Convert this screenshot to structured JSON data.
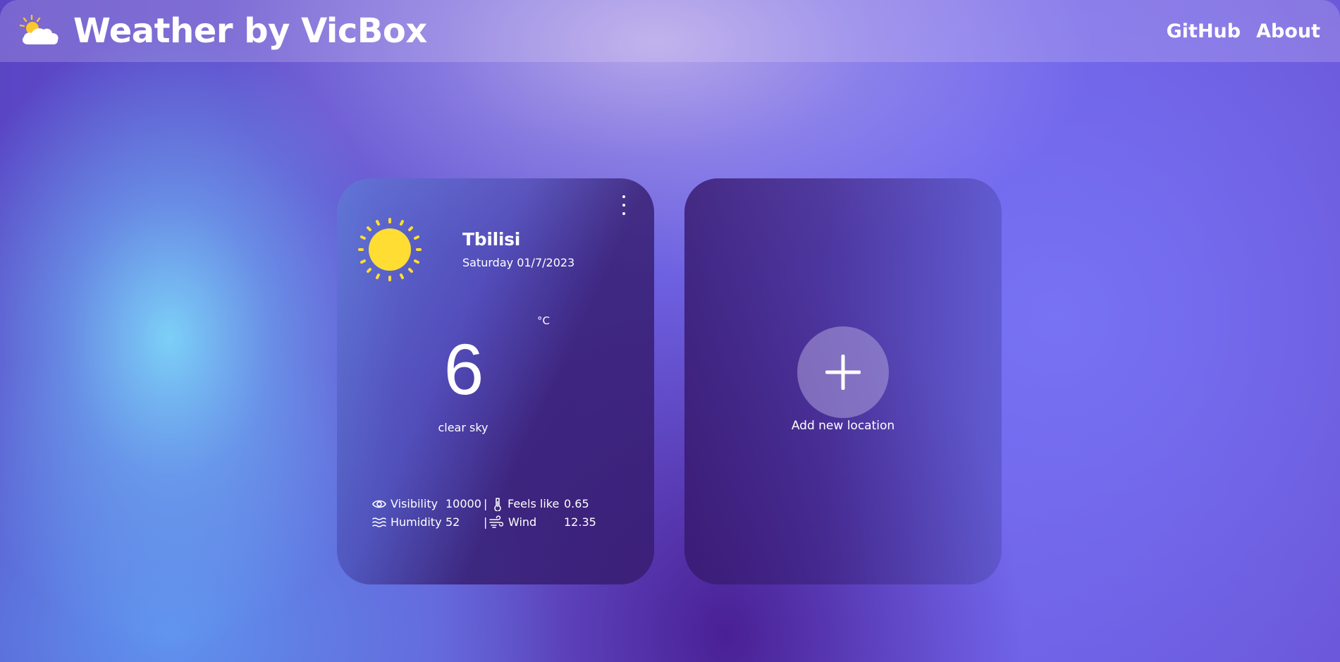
{
  "header": {
    "title": "Weather by VicBox",
    "logo_icon": "partly-cloudy-icon",
    "nav": {
      "github": "GitHub",
      "about": "About"
    }
  },
  "weather_card": {
    "menu_icon": "more-vertical-icon",
    "weather_icon": "sun-icon",
    "city": "Tbilisi",
    "date": "Saturday 01/7/2023",
    "unit": "°C",
    "temperature": "6",
    "condition": "clear sky",
    "stats": {
      "visibility": {
        "icon": "eye-icon",
        "label": "Visibility",
        "value": "10000"
      },
      "feels_like": {
        "icon": "thermometer-icon",
        "label": "Feels like",
        "value": "0.65"
      },
      "humidity": {
        "icon": "humidity-waves-icon",
        "label": "Humidity",
        "value": "52"
      },
      "wind": {
        "icon": "wind-icon",
        "label": "Wind",
        "value": "12.35"
      },
      "separator": "|"
    }
  },
  "add_card": {
    "icon": "plus-icon",
    "label": "Add new location"
  },
  "colors": {
    "sun": "#FFDD33",
    "card_dark": "#3A1E78",
    "text": "#FFFFFF"
  }
}
